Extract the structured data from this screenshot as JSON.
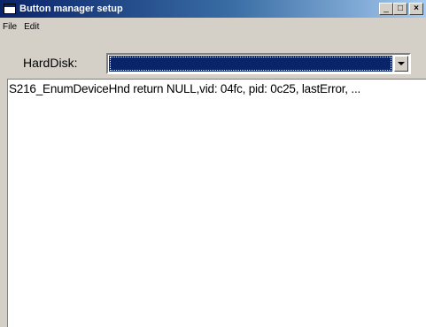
{
  "window": {
    "title": "Button manager setup",
    "minimize_glyph": "_",
    "maximize_glyph": "□",
    "close_glyph": "×"
  },
  "menu": {
    "items": [
      "File",
      "Edit"
    ]
  },
  "harddisk": {
    "label": "HardDisk:",
    "selected_value": ""
  },
  "log": {
    "lines": [
      "S216_EnumDeviceHnd return NULL,vid: 04fc, pid: 0c25, lastError, ..."
    ]
  },
  "colors": {
    "titlebar_start": "#0a246a",
    "titlebar_end": "#a6caf0",
    "window_bg": "#d4d0c8",
    "selection": "#0a246a"
  }
}
